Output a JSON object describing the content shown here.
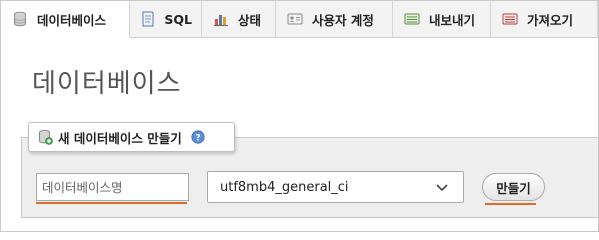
{
  "tabs": [
    {
      "label": "데이터베이스",
      "icon": "database-icon",
      "active": true
    },
    {
      "label": "SQL",
      "icon": "sql-icon",
      "active": false
    },
    {
      "label": "상태",
      "icon": "status-chart-icon",
      "active": false
    },
    {
      "label": "사용자 계정",
      "icon": "user-accounts-icon",
      "active": false
    },
    {
      "label": "내보내기",
      "icon": "export-icon",
      "active": false
    },
    {
      "label": "가져오기",
      "icon": "import-icon",
      "active": false
    }
  ],
  "page": {
    "title": "데이터베이스"
  },
  "create_db": {
    "legend": "새 데이터베이스 만들기",
    "name_placeholder": "데이터베이스명",
    "collation_selected": "utf8mb4_general_ci",
    "button_label": "만들기"
  },
  "colors": {
    "accent_underline": "#e06b2a",
    "panel_bg": "#eeeeee",
    "tabbar_bg": "#f3f3f3"
  }
}
